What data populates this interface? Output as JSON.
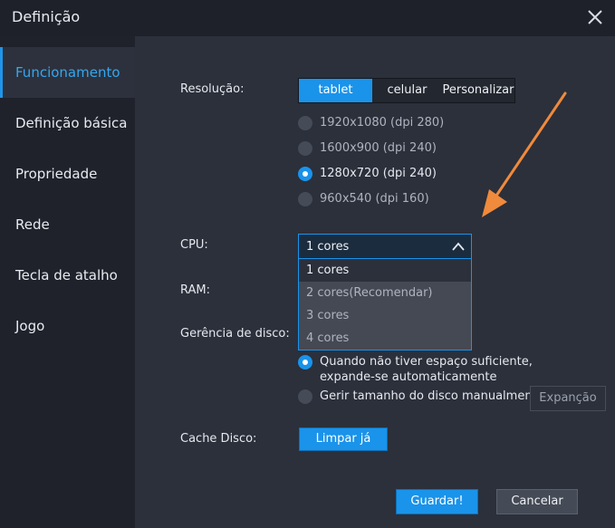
{
  "window": {
    "title": "Definição"
  },
  "sidebar": {
    "items": [
      {
        "label": "Funcionamento",
        "active": true
      },
      {
        "label": "Definição básica"
      },
      {
        "label": "Propriedade"
      },
      {
        "label": "Rede"
      },
      {
        "label": "Tecla de atalho"
      },
      {
        "label": "Jogo"
      }
    ]
  },
  "resolution": {
    "label": "Resolução:",
    "tabs": [
      "tablet",
      "celular",
      "Personalizar"
    ],
    "options": [
      {
        "label": "1920x1080  (dpi 280)"
      },
      {
        "label": "1600x900  (dpi 240)"
      },
      {
        "label": "1280x720  (dpi 240)"
      },
      {
        "label": "960x540  (dpi 160)"
      }
    ]
  },
  "cpu": {
    "label": "CPU:",
    "value": "1 cores",
    "options": [
      "1 cores",
      "2 cores(Recomendar)",
      "3 cores",
      "4 cores"
    ]
  },
  "ram": {
    "label": "RAM:"
  },
  "disk": {
    "label": "Gerência de disco:",
    "auto_line1": "Quando não tiver espaço suficiente,",
    "auto_line2": "expande-se automaticamente",
    "manual": "Gerir tamanho do disco manualmente",
    "expand_button": "Expanção"
  },
  "cache": {
    "label": "Cache Disco:",
    "clear_button": "Limpar já"
  },
  "footer": {
    "save": "Guardar!",
    "cancel": "Cancelar"
  },
  "colors": {
    "accent": "#1a93ea",
    "annotation_arrow": "#f08a3c"
  }
}
